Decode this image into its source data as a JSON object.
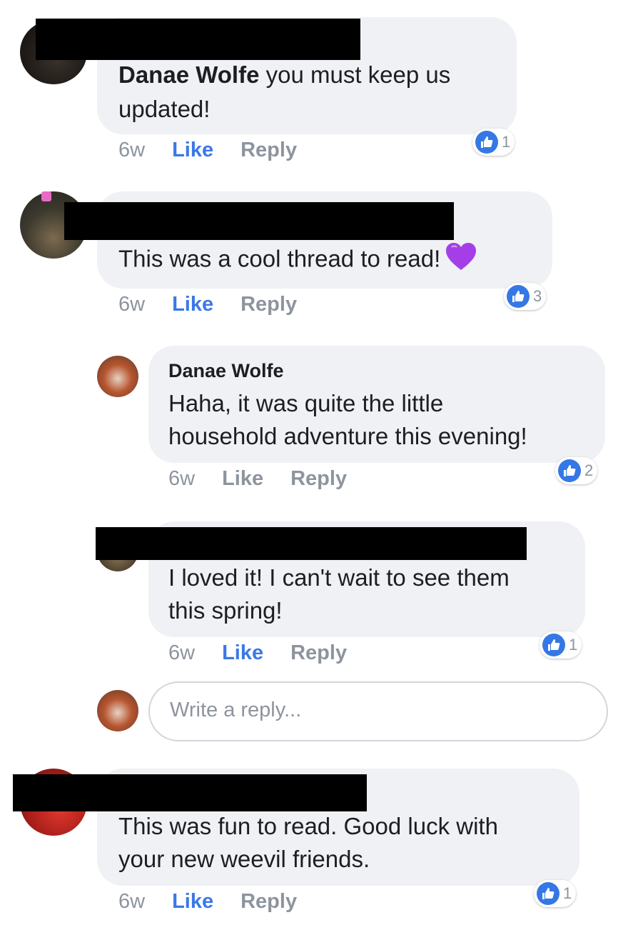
{
  "comments": [
    {
      "author": "Danae Wolfe",
      "text_line1_rest": " you must keep us",
      "text_line2": "updated!",
      "time": "6w",
      "like": "Like",
      "reply": "Reply",
      "reactions": "1"
    },
    {
      "text": "This was a cool thread to read!",
      "emoji": "purple-heart",
      "time": "6w",
      "like": "Like",
      "reply": "Reply",
      "reactions": "3"
    },
    {
      "author": "Danae Wolfe",
      "text_line1": "Haha, it was quite the little",
      "text_line2": "household adventure this evening!",
      "time": "6w",
      "like": "Like",
      "reply": "Reply",
      "reactions": "2"
    },
    {
      "text_line1": "I loved it! I can't wait to see them",
      "text_line2": "this spring!",
      "time": "6w",
      "like": "Like",
      "reply": "Reply",
      "reactions": "1"
    },
    {
      "text_line1": "This was fun to read. Good luck with",
      "text_line2": "your new weevil friends.",
      "time": "6w",
      "like": "Like",
      "reply": "Reply",
      "reactions": "1"
    }
  ],
  "reply_box": {
    "placeholder": "Write a reply..."
  },
  "colors": {
    "like_active": "#3b78e7",
    "bubble": "#f0f1f4",
    "reaction": "#3578e5"
  }
}
